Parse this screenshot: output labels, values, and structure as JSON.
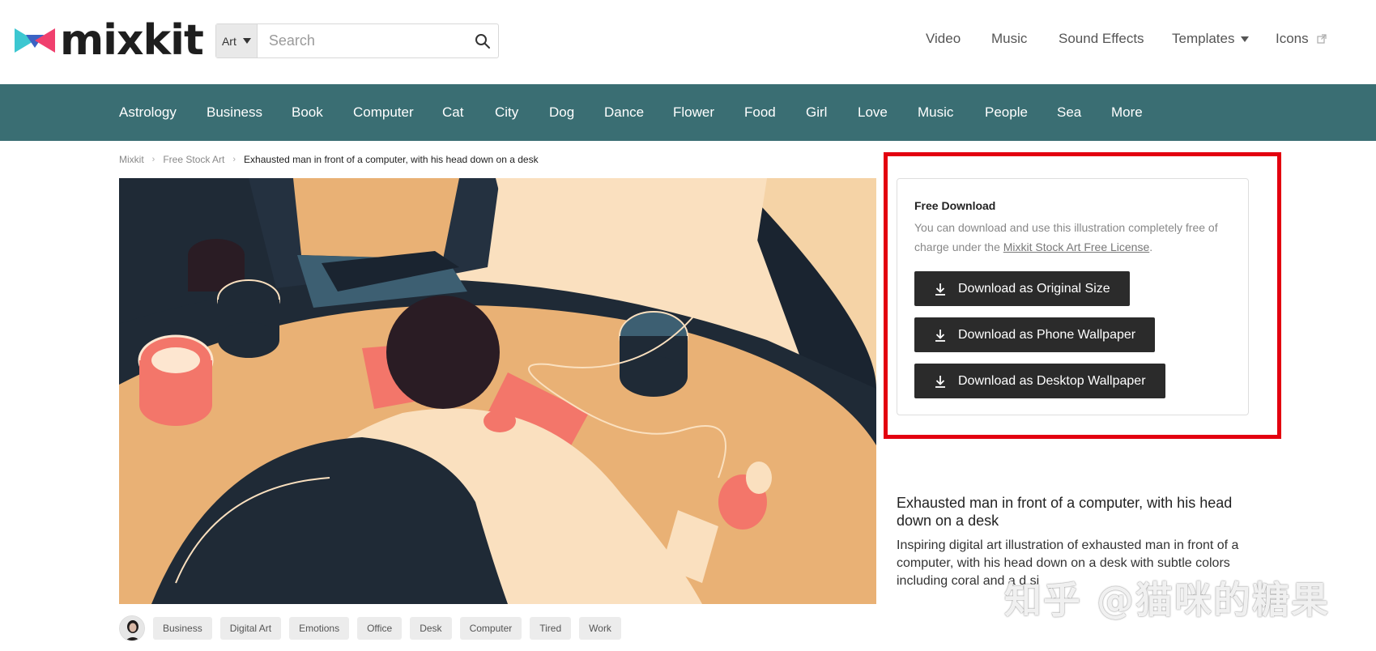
{
  "brand": {
    "name": "mixkit"
  },
  "search": {
    "category": "Art",
    "placeholder": "Search",
    "icon": "search-icon"
  },
  "topnav": {
    "items": [
      {
        "label": "Video"
      },
      {
        "label": "Music"
      },
      {
        "label": "Sound Effects"
      },
      {
        "label": "Templates",
        "icon": "caret-down-icon"
      },
      {
        "label": "Icons",
        "icon": "external-link-icon"
      }
    ]
  },
  "categories": [
    "Astrology",
    "Business",
    "Book",
    "Computer",
    "Cat",
    "City",
    "Dog",
    "Dance",
    "Flower",
    "Food",
    "Girl",
    "Love",
    "Music",
    "People",
    "Sea",
    "More"
  ],
  "breadcrumb": {
    "items": [
      "Mixkit",
      "Free Stock Art",
      "Exhausted man in front of a computer, with his head down on a desk"
    ]
  },
  "download": {
    "title": "Free Download",
    "desc_before": "You can download and use this illustration completely free of charge under the ",
    "license_link": "Mixkit Stock Art Free License",
    "desc_after": ".",
    "buttons": [
      {
        "label": "Download as Original Size"
      },
      {
        "label": "Download as Phone Wallpaper"
      },
      {
        "label": "Download as Desktop Wallpaper"
      }
    ]
  },
  "artwork": {
    "title": "Exhausted man in front of a computer, with his head down on a desk",
    "description": "Inspiring digital art illustration of exhausted man in front of a computer, with his head down on a desk with subtle colors including coral and",
    "description_tail": "a d si"
  },
  "tags": [
    "Business",
    "Digital Art",
    "Emotions",
    "Office",
    "Desk",
    "Computer",
    "Tired",
    "Work"
  ],
  "watermark": "知乎 @猫咪的糖果",
  "colors": {
    "category_bar": "#3a6e73",
    "button": "#2b2b2b",
    "highlight": "#e3000f",
    "art_desk": "#e9b175",
    "art_dark": "#1f2a36",
    "art_coral": "#f3766a"
  }
}
